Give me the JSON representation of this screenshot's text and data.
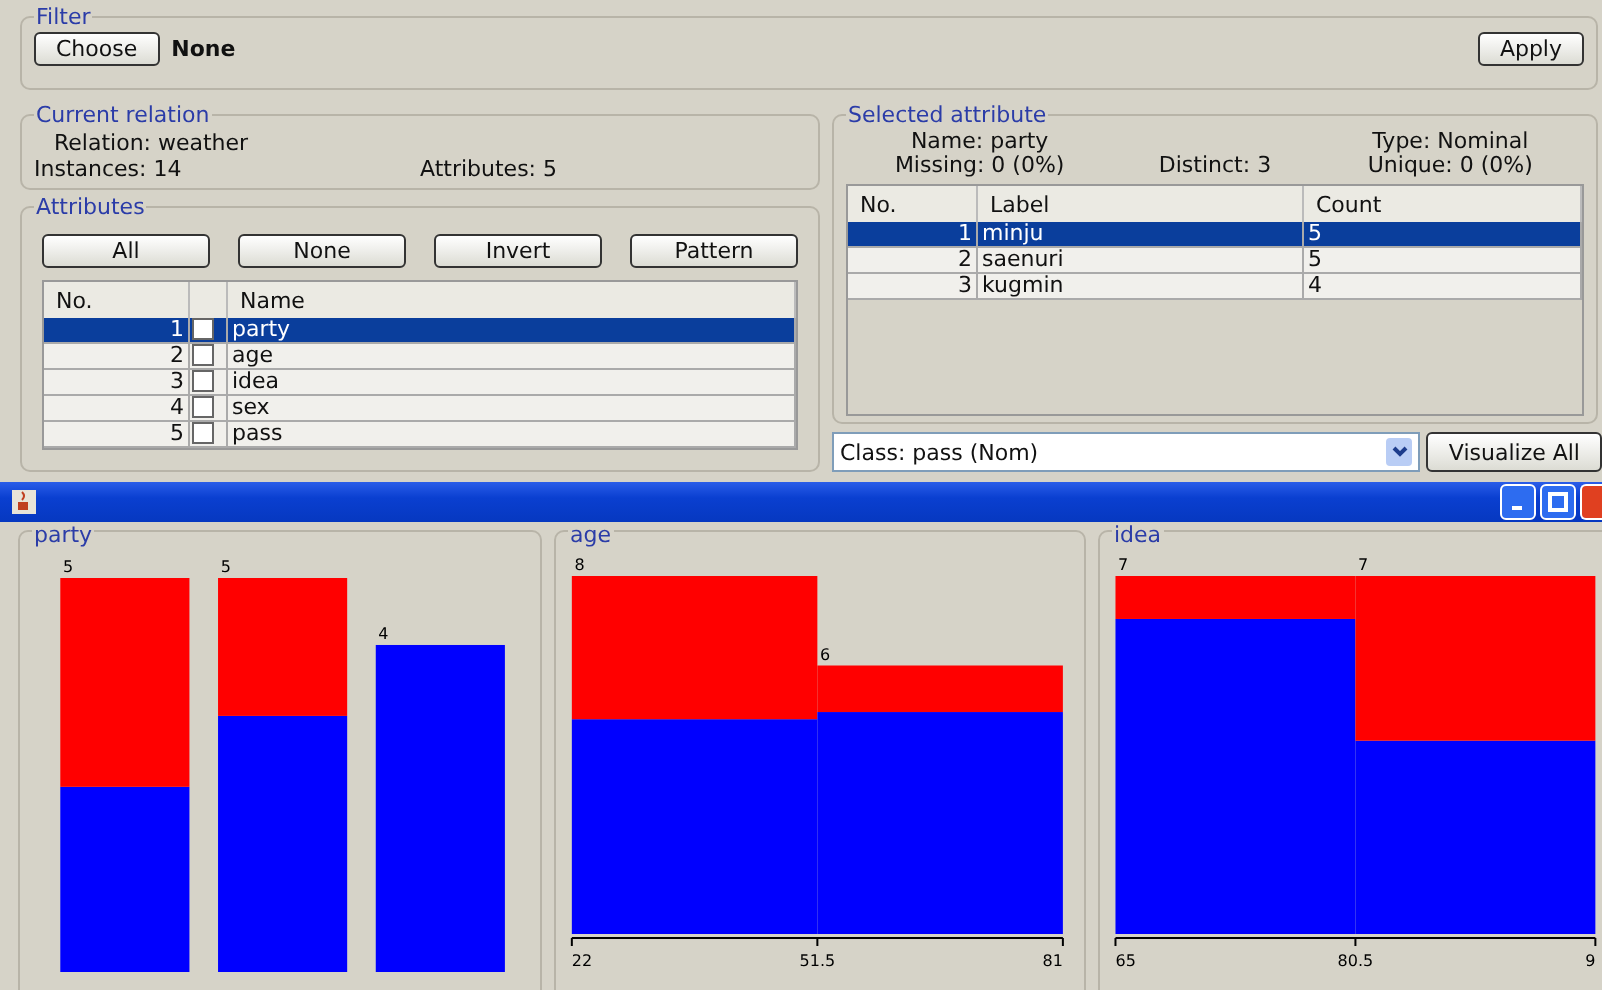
{
  "filter": {
    "title": "Filter",
    "choose_button": "Choose",
    "value": "None",
    "apply_button": "Apply"
  },
  "current_relation": {
    "title": "Current relation",
    "relation": "Relation: weather",
    "instances": "Instances: 14",
    "attributes": "Attributes: 5"
  },
  "attributes": {
    "title": "Attributes",
    "buttons": [
      "All",
      "None",
      "Invert",
      "Pattern"
    ],
    "columns": [
      "No.",
      "Name"
    ],
    "rows": [
      {
        "no": "1",
        "name": "party",
        "checked": false,
        "selected": true
      },
      {
        "no": "2",
        "name": "age",
        "checked": false,
        "selected": false
      },
      {
        "no": "3",
        "name": "idea",
        "checked": false,
        "selected": false
      },
      {
        "no": "4",
        "name": "sex",
        "checked": false,
        "selected": false
      },
      {
        "no": "5",
        "name": "pass",
        "checked": false,
        "selected": false
      }
    ]
  },
  "selected_attribute": {
    "title": "Selected attribute",
    "name": "Name: party",
    "type": "Type: Nominal",
    "missing": "Missing: 0 (0%)",
    "distinct": "Distinct: 3",
    "unique": "Unique: 0 (0%)",
    "columns": [
      "No.",
      "Label",
      "Count"
    ],
    "rows": [
      {
        "no": "1",
        "label": "minju",
        "count": "5",
        "selected": true
      },
      {
        "no": "2",
        "label": "saenuri",
        "count": "5",
        "selected": false
      },
      {
        "no": "3",
        "label": "kugmin",
        "count": "4",
        "selected": false
      }
    ]
  },
  "class_select": {
    "value": "Class: pass (Nom)"
  },
  "visualize_button": "Visualize All",
  "panels": [
    {
      "title": "party",
      "kind": "nominal",
      "bars": [
        {
          "count": "5",
          "segments": [
            {
              "color": "#0000ff"
            },
            {
              "color": "#ff0000"
            }
          ]
        },
        {
          "count": "5",
          "segments": [
            {
              "color": "#0000ff"
            },
            {
              "color": "#ff0000"
            }
          ]
        },
        {
          "count": "4",
          "segments": [
            {
              "color": "#0000ff"
            }
          ]
        }
      ]
    },
    {
      "title": "age",
      "kind": "numeric",
      "ticks": [
        "22",
        "51.5",
        "81"
      ],
      "bars": [
        {
          "count": "8",
          "segments": [
            {
              "color": "#0000ff"
            },
            {
              "color": "#ff0000"
            }
          ]
        },
        {
          "count": "6",
          "segments": [
            {
              "color": "#0000ff"
            },
            {
              "color": "#ff0000"
            }
          ]
        }
      ]
    },
    {
      "title": "idea",
      "kind": "numeric",
      "ticks": [
        "65",
        "80.5",
        "9"
      ],
      "bars": [
        {
          "count": "7",
          "segments": [
            {
              "color": "#0000ff"
            },
            {
              "color": "#ff0000"
            }
          ]
        },
        {
          "count": "7",
          "segments": [
            {
              "color": "#0000ff"
            },
            {
              "color": "#ff0000"
            }
          ]
        }
      ]
    }
  ]
}
